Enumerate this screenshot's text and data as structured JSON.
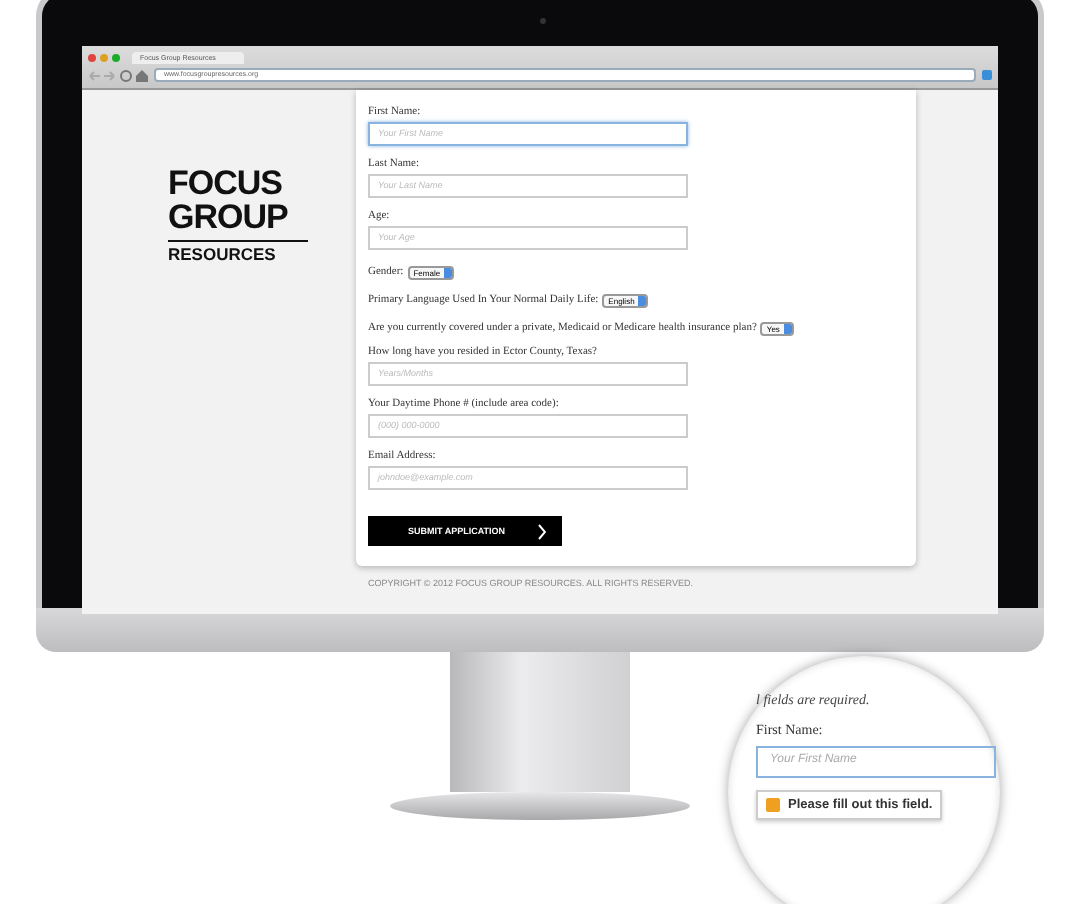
{
  "browser": {
    "tab_title": "Focus Group Resources",
    "url": "www.focusgroupresources.org"
  },
  "logo": {
    "lines": [
      "FOCUS",
      "GROUP"
    ],
    "tagline": "RESOURCES"
  },
  "form": {
    "fields": [
      {
        "kind": "text",
        "label": "First Name:",
        "placeholder": "Your First Name",
        "focused": true
      },
      {
        "kind": "text",
        "label": "Last Name:",
        "placeholder": "Your Last Name",
        "focused": false
      },
      {
        "kind": "text",
        "label": "Age:",
        "placeholder": "Your Age",
        "focused": false
      },
      {
        "kind": "select",
        "label": "Gender:",
        "value": "Female"
      },
      {
        "kind": "select",
        "label": "Primary Language Used In Your Normal Daily Life:",
        "value": "English"
      },
      {
        "kind": "select",
        "label": "Are you currently covered under a private, Medicaid or Medicare health insurance plan?",
        "value": "Yes"
      },
      {
        "kind": "text",
        "label": "How long have you resided in Ector County, Texas?",
        "placeholder": "Years/Months",
        "focused": false
      },
      {
        "kind": "text",
        "label": "Your Daytime Phone # (include area code):",
        "placeholder": "(000) 000-0000",
        "focused": false
      },
      {
        "kind": "text",
        "label": "Email Address:",
        "placeholder": "johndoe@example.com",
        "focused": false
      }
    ],
    "submit": "SUBMIT APPLICATION"
  },
  "copyright": "COPYRIGHT © 2012 FOCUS GROUP RESOURCES. ALL RIGHTS RESERVED.",
  "magnifier": {
    "note": "l fields are required.",
    "label": "First Name:",
    "placeholder": "Your First Name",
    "tooltip": "Please fill out this field."
  }
}
